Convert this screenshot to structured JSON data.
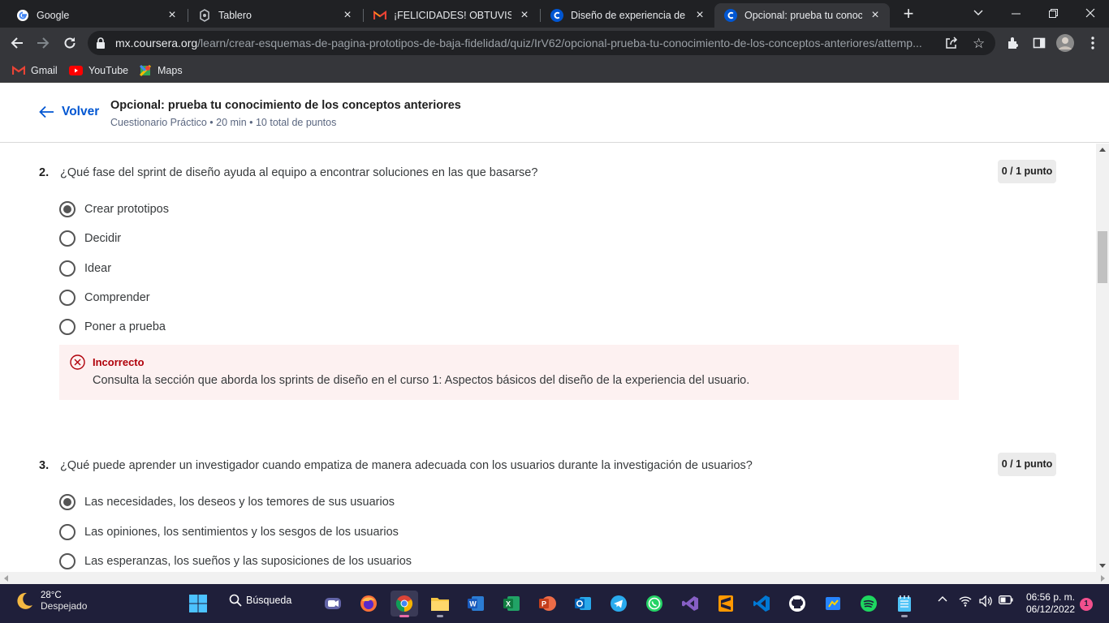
{
  "browser": {
    "tabs": [
      {
        "title": "Google",
        "icon": "google-icon",
        "active": false
      },
      {
        "title": "Tablero",
        "icon": "tablero-icon",
        "active": false
      },
      {
        "title": "¡FELICIDADES! OBTUVISTE LA",
        "icon": "gmail-icon",
        "active": false
      },
      {
        "title": "Diseño de experiencia de usu",
        "icon": "coursera-icon",
        "active": false
      },
      {
        "title": "Opcional: prueba tu conocim",
        "icon": "coursera-icon",
        "active": true
      }
    ],
    "url_host": "mx.coursera.org",
    "url_path": "/learn/crear-esquemas-de-pagina-prototipos-de-baja-fidelidad/quiz/IrV62/opcional-prueba-tu-conocimiento-de-los-conceptos-anteriores/attemp...",
    "bookmarks": [
      {
        "label": "Gmail",
        "icon": "gmail-icon"
      },
      {
        "label": "YouTube",
        "icon": "youtube-icon"
      },
      {
        "label": "Maps",
        "icon": "maps-icon"
      }
    ]
  },
  "header": {
    "back_label": "Volver",
    "title": "Opcional: prueba tu conocimiento de los conceptos anteriores",
    "subtitle": "Cuestionario Práctico • 20 min • 10 total de puntos"
  },
  "questions": [
    {
      "number": "2.",
      "text": "¿Qué fase del sprint de diseño ayuda al equipo a encontrar soluciones en las que basarse?",
      "score": "0 / 1 punto",
      "options": [
        {
          "label": "Crear prototipos",
          "selected": true
        },
        {
          "label": "Decidir",
          "selected": false
        },
        {
          "label": "Idear",
          "selected": false
        },
        {
          "label": "Comprender",
          "selected": false
        },
        {
          "label": "Poner a prueba",
          "selected": false
        }
      ],
      "feedback": {
        "status": "Incorrecto",
        "message": "Consulta la sección que aborda los sprints de diseño en el curso 1: Aspectos básicos del diseño de la experiencia del usuario."
      }
    },
    {
      "number": "3.",
      "text": "¿Qué puede aprender un investigador cuando empatiza de manera adecuada con los usuarios durante la investigación de usuarios?",
      "score": "0 / 1 punto",
      "options": [
        {
          "label": "Las necesidades, los deseos y los temores de sus usuarios",
          "selected": true
        },
        {
          "label": "Las opiniones, los sentimientos y los sesgos de los usuarios",
          "selected": false
        },
        {
          "label": "Las esperanzas, los sueños y las suposiciones de los usuarios",
          "selected": false
        }
      ]
    }
  ],
  "taskbar": {
    "weather_temp": "28°C",
    "weather_condition": "Despejado",
    "search_label": "Búsqueda",
    "time": "06:56 p. m.",
    "date": "06/12/2022",
    "notification_count": "1"
  },
  "colors": {
    "accent": "#0056d2",
    "error": "#b0000a",
    "error_bg": "#fdf1f1",
    "chrome_dark": "#202124",
    "chrome_toolbar": "#35363a",
    "taskbar": "#1f1f3a"
  }
}
